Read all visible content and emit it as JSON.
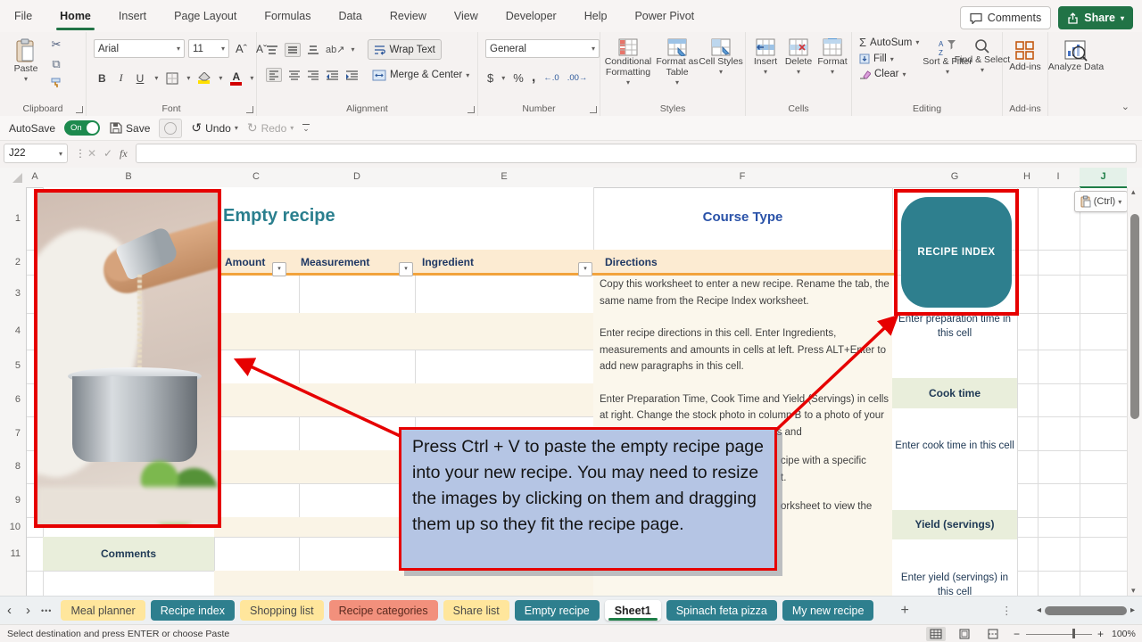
{
  "colors": {
    "excel_green": "#217346",
    "teal": "#2e7f8e",
    "title_teal": "#2a7f8e",
    "course_blue": "#2a52a8",
    "annotation_red": "#e60000",
    "callout_bg": "#b5c5e4",
    "header_band": "#fcebd2",
    "band_orange": "#f2a33c",
    "cell_green": "#e9eedb",
    "tab_yellow": "#ffe69c",
    "tab_salmon": "#f2907c",
    "directions_cream": "#fbf7ec",
    "navy": "#1f3864"
  },
  "icons": {
    "caret": "▾",
    "chevron": "⌄",
    "scissors": "✂",
    "copy": "⧉",
    "sigma": "Σ",
    "dollar": "$",
    "percent": "%",
    "comma": ",",
    "undo": "↺",
    "redo": "↻",
    "check": "✓",
    "close": "✕",
    "fx": "fx",
    "nav_left": "‹",
    "nav_right": "›",
    "dots": "•••",
    "vdots": "⋮",
    "plus": "+",
    "tri_left": "◂",
    "tri_right": "▸",
    "tri_up": "▴",
    "tri_down": "▾",
    "minus": "−",
    "bold": "B",
    "italic": "I",
    "underline": "U",
    "grow": "Aˆ",
    "shrink": "Aˇ",
    "orient": "ab↗",
    "inc_decimal": "←.0",
    "dec_decimal": ".00→"
  },
  "titlebar": {
    "tabs": [
      "File",
      "Home",
      "Insert",
      "Page Layout",
      "Formulas",
      "Data",
      "Review",
      "View",
      "Developer",
      "Help",
      "Power Pivot"
    ],
    "active_tab": "Home",
    "comments": "Comments",
    "share": "Share"
  },
  "qat": {
    "autosave": "AutoSave",
    "autosave_state": "On",
    "save": "Save",
    "undo": "Undo",
    "redo": "Redo"
  },
  "ribbon": {
    "group_labels": [
      "Clipboard",
      "Font",
      "Alignment",
      "Number",
      "Styles",
      "Cells",
      "Editing",
      "Add-ins"
    ],
    "clipboard": {
      "paste": "Paste"
    },
    "font": {
      "name": "Arial",
      "size": "11"
    },
    "alignment": {
      "wrap": "Wrap Text",
      "merge": "Merge & Center"
    },
    "number": {
      "format": "General"
    },
    "styles": {
      "conditional": "Conditional Formatting",
      "format_table": "Format as Table",
      "cell_styles": "Cell Styles"
    },
    "cells": {
      "insert": "Insert",
      "delete": "Delete",
      "format": "Format"
    },
    "editing": {
      "autosum": "AutoSum",
      "fill": "Fill",
      "clear": "Clear",
      "sort": "Sort & Filter",
      "find": "Find & Select"
    },
    "addins": {
      "addins": "Add-ins",
      "analyze": "Analyze Data"
    }
  },
  "formula_bar": {
    "name_box": "J22",
    "value": ""
  },
  "grid": {
    "columns": [
      "A",
      "B",
      "C",
      "D",
      "E",
      "F",
      "G",
      "H",
      "I",
      "J"
    ],
    "rows": [
      "1",
      "2",
      "3",
      "4",
      "5",
      "6",
      "7",
      "8",
      "9",
      "10",
      "11"
    ]
  },
  "content": {
    "title": "Empty recipe",
    "course_type": "Course Type",
    "recipe_index": "RECIPE INDEX",
    "col_headers": [
      "Amount",
      "Measurement",
      "Ingredient",
      "Directions"
    ],
    "directions": [
      "Copy this worksheet to enter a new recipe. Rename the tab, the same name from the Recipe Index worksheet.",
      "Enter recipe directions in this cell. Enter Ingredients, measurements and amounts in cells at left. Press ALT+Enter to add new paragraphs in this cell.",
      "Enter Preparation Time, Cook Time and Yield (Servings) in cells at right. Change the stock photo in column B to a photo of your recipe, then enter Calories, Recipe Tags and"
    ],
    "fragments": [
      "cipe with a specific",
      "t.",
      "orksheet to view the"
    ],
    "prep": "Enter preparation time in this cell",
    "cook_header": "Cook time",
    "cook": "Enter cook time in this cell",
    "yield_header": "Yield (servings)",
    "yield": "Enter yield (servings) in this cell",
    "comments": "Comments",
    "paste_options": "(Ctrl)"
  },
  "callout": {
    "text": "Press Ctrl + V to paste the empty recipe page into your new recipe. You may need to resize the images by clicking on them and dragging them up so they fit the recipe page."
  },
  "sheet_tabs": {
    "items": [
      {
        "label": "Meal planner",
        "color": "#ffe69c"
      },
      {
        "label": "Recipe index",
        "color": "#2e7f8e"
      },
      {
        "label": "Shopping list",
        "color": "#ffe69c"
      },
      {
        "label": "Recipe categories",
        "color": "#f2907c"
      },
      {
        "label": "Share list",
        "color": "#ffe69c"
      },
      {
        "label": "Empty recipe",
        "color": "#2e7f8e"
      },
      {
        "label": "Sheet1",
        "color": "#ffffff",
        "active": true
      },
      {
        "label": "Spinach feta pizza",
        "color": "#2e7f8e"
      },
      {
        "label": "My new recipe",
        "color": "#2e7f8e"
      }
    ],
    "add": "+"
  },
  "status": {
    "message": "Select destination and press ENTER or choose Paste",
    "zoom": "100%"
  }
}
